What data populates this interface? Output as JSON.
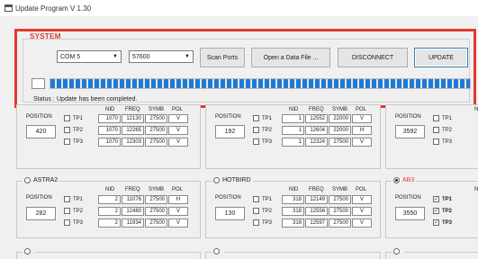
{
  "window": {
    "title": "Update Program V 1.30"
  },
  "system": {
    "label": "SYSTEM",
    "com_port": "COM 5",
    "baud_rate": "57600",
    "buttons": {
      "scan": "Scan Ports",
      "open": "Open a Data File ...",
      "disconnect": "DISCONNECT",
      "update": "UPDATE"
    },
    "progress": 1.0,
    "status_label": "Status :",
    "status_text": "Update has been completed."
  },
  "panels": [
    {
      "name": "",
      "position": "420",
      "tps": [
        {
          "label": "TP1",
          "checked": false,
          "nid": "1070",
          "freq": "12130",
          "symb": "27500",
          "pol": "V"
        },
        {
          "label": "TP2",
          "checked": false,
          "nid": "1070",
          "freq": "12265",
          "symb": "27500",
          "pol": "V"
        },
        {
          "label": "TP3",
          "checked": false,
          "nid": "1070",
          "freq": "12303",
          "symb": "27500",
          "pol": "V"
        }
      ]
    },
    {
      "name": "",
      "position": "192",
      "tps": [
        {
          "label": "TP1",
          "checked": false,
          "nid": "1",
          "freq": "12552",
          "symb": "22000",
          "pol": "V"
        },
        {
          "label": "TP2",
          "checked": false,
          "nid": "1",
          "freq": "12604",
          "symb": "22000",
          "pol": "H"
        },
        {
          "label": "TP3",
          "checked": false,
          "nid": "1",
          "freq": "12324",
          "symb": "27500",
          "pol": "V"
        }
      ]
    },
    {
      "name": "",
      "position": "3592",
      "tps": [
        {
          "label": "TP1",
          "checked": false
        },
        {
          "label": "TP2",
          "checked": false
        },
        {
          "label": "TP3",
          "checked": false
        }
      ]
    },
    {
      "name": "ASTRA2",
      "selected": false,
      "position": "282",
      "tps": [
        {
          "label": "TP1",
          "checked": false,
          "nid": "2",
          "freq": "11076",
          "symb": "27500",
          "pol": "H"
        },
        {
          "label": "TP2",
          "checked": false,
          "nid": "2",
          "freq": "12480",
          "symb": "27500",
          "pol": "V"
        },
        {
          "label": "TP3",
          "checked": false,
          "nid": "2",
          "freq": "11934",
          "symb": "27500",
          "pol": "V"
        }
      ]
    },
    {
      "name": "HOTBIRD",
      "selected": false,
      "position": "130",
      "tps": [
        {
          "label": "TP1",
          "checked": false,
          "nid": "318",
          "freq": "12149",
          "symb": "27500",
          "pol": "V"
        },
        {
          "label": "TP2",
          "checked": false,
          "nid": "318",
          "freq": "12556",
          "symb": "27500",
          "pol": "V"
        },
        {
          "label": "TP3",
          "checked": false,
          "nid": "318",
          "freq": "12597",
          "symb": "27500",
          "pol": "V"
        }
      ]
    },
    {
      "name": "AB3",
      "selected": true,
      "position": "3550",
      "tps": [
        {
          "label": "TP1",
          "checked": true
        },
        {
          "label": "TP2",
          "checked": true
        },
        {
          "label": "TP3",
          "checked": true
        }
      ]
    }
  ],
  "table_headers": {
    "position": "POSITION",
    "nid": "NID",
    "freq": "FREQ",
    "symb": "SYMB",
    "pol": "POL",
    "nid_cut": "N"
  },
  "colors": {
    "accent_red": "#e23a2f",
    "progress_blue": "#1e7ad6"
  },
  "icons": {
    "app": "window-icon",
    "dropdown": "chevron-down-icon"
  }
}
